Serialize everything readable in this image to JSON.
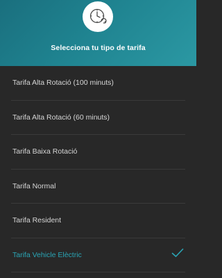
{
  "header": {
    "icon": "clock-icon",
    "title": "Selecciona tu tipo de tarifa",
    "accent_color": "#1f8390"
  },
  "tariffs": [
    {
      "label": "Tarifa Alta Rotació (100 minuts)",
      "selected": false
    },
    {
      "label": "Tarifa Alta Rotació (60 minuts)",
      "selected": false
    },
    {
      "label": "Tarifa Baixa Rotació",
      "selected": false
    },
    {
      "label": "Tarifa Normal",
      "selected": false
    },
    {
      "label": "Tarifa Resident",
      "selected": false
    },
    {
      "label": "Tarifa Vehicle Elèctric",
      "selected": true
    }
  ],
  "selected_color": "#2aa5b5",
  "check_icon": "checkmark-icon"
}
